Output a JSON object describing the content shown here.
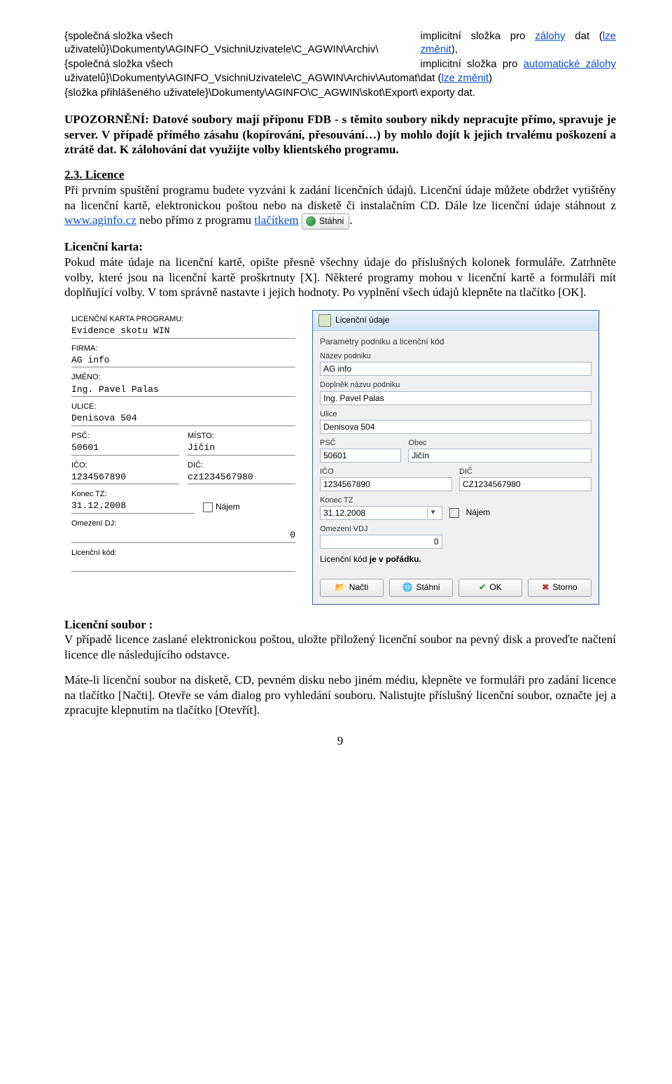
{
  "paths_table": {
    "rows": [
      {
        "left": "{společná složka všech uživatelů}\\Dokumenty\\AGINFO_VsichniUzivatele\\C_AGWIN\\Archiv\\",
        "right_pre": "implicitní složka pro ",
        "right_link": "zálohy",
        "right_mid": " dat (",
        "right_link2": "lze změnit",
        "right_post": "),"
      },
      {
        "left": "{společná složka všech uživatelů}\\Dokumenty\\AGINFO_VsichniUzivatele\\C_AGWIN\\Archiv\\Automat\\",
        "right_pre": "implicitní složka pro ",
        "right_link": "automatické zálohy",
        "right_mid": " dat (",
        "right_link2": "lze změnit",
        "right_post": ")"
      },
      {
        "left": "{složka přihlášeného uživatele}\\Dokumenty\\AGINFO\\C_AGWIN\\skot\\Export\\",
        "right_pre": "exporty dat.",
        "right_link": "",
        "right_mid": "",
        "right_link2": "",
        "right_post": ""
      }
    ]
  },
  "warning": {
    "heading": "UPOZORNĚNÍ:",
    "body": " Datové soubory mají příponu FDB - s těmito soubory nikdy nepracujte přímo, spravuje je server. V případě přímého zásahu (kopírování, přesouvání…) by mohlo dojít k jejich trvalému poškození a ztrátě dat. K zálohování dat využijte volby klientského programu."
  },
  "section": {
    "number_title": "2.3. Licence",
    "p1a": "Při prvním spuštění programu budete vyzváni k zadání licenčních údajů. Licenční údaje můžete obdržet vytištěny na licenční kartě, elektronickou poštou nebo na disketě či instalačním CD. Dále lze licenční údaje stáhnout z ",
    "link1": "www.aginfo.cz",
    "p1b": " nebo přímo z programu ",
    "link2": "tlačítkem",
    "inline_btn": "Stáhni",
    "p1c": "."
  },
  "lic_card": {
    "heading": "Licenční karta:",
    "intro": "Pokud máte údaje na licenční kartě, opište přesně všechny údaje do příslušných kolonek formuláře. Zatrhněte volby, které jsou na licenční kartě proškrtnuty [X]. Některé programy mohou v licenční kartě a formuláři mít doplňující volby. V tom správně nastavte i jejich hodnoty. Po vyplnění všech údajů klepněte na tlačítko [OK].",
    "card": {
      "title": "LICENČNÍ KARTA PROGRAMU:",
      "program": "Evidence skotu WIN",
      "l_firma": "FIRMA:",
      "firma": "AG info",
      "l_jmeno": "JMÉNO:",
      "jmeno": "Ing. Pavel Palas",
      "l_ulice": "ULICE:",
      "ulice": "Denisova 504",
      "l_psc": "PSČ:",
      "psc": "50601",
      "l_misto": "MÍSTO:",
      "misto": "Jičín",
      "l_ico": "IČO:",
      "ico": "1234567890",
      "l_dic": "DIČ:",
      "dic": "cz1234567980",
      "l_konec": "Konec TZ:",
      "konec": "31.12.2008",
      "najem": "Nájem",
      "l_omez": "Omezení DJ:",
      "omez": "0",
      "l_kod": "Licenční kód:",
      "kod": ""
    },
    "dialog": {
      "title": "Licenční údaje",
      "group": "Parametry podniku a licenční kód",
      "l_nazev": "Název podniku",
      "nazev": "AG info",
      "l_dopl": "Doplněk názvu podniku",
      "dopl": "Ing. Pavel Palas",
      "l_ulice": "Ulice",
      "ulice": "Denisova 504",
      "l_psc": "PSČ",
      "psc": "50601",
      "l_obec": "Obec",
      "obec": "Jičín",
      "l_ico": "IČO",
      "ico": "1234567890",
      "l_dic": "DIČ",
      "dic": "CZ1234567980",
      "l_konec": "Konec TZ",
      "konec": "31.12.2008",
      "najem": "Nájem",
      "l_omez": "Omezení VDJ",
      "omez": "0",
      "l_status_a": "Licenční kód ",
      "l_status_b": "je v pořádku.",
      "btn_nacti": "Načti",
      "btn_stahni": "Stáhni",
      "btn_ok": "OK",
      "btn_storno": "Storno"
    }
  },
  "lic_file": {
    "heading": "Licenční soubor :",
    "p1": "V případě licence zaslané elektronickou poštou, uložte přiložený licenční soubor na pevný disk a proveďte načtení licence dle následujícího odstavce.",
    "p2": "Máte-li licenční soubor na disketě, CD, pevném disku nebo jiném médiu, klepněte ve formuláři pro zadání licence na tlačítko [Načti]. Otevře se vám dialog pro vyhledání souboru. Nalistujte příslušný licenční soubor, označte jej a zpracujte klepnutím na tlačítko [Otevřít]."
  },
  "page_number": "9"
}
